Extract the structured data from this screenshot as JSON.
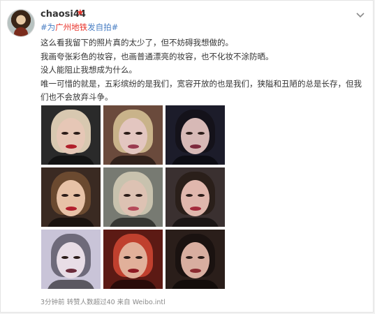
{
  "user": {
    "name": "chaosi44"
  },
  "topic": {
    "prefix": "#为",
    "highlight": "广州地铁",
    "suffix": "发自拍#"
  },
  "post": {
    "lines": [
      "这么看我留下的照片真的太少了，但不妨碍我想做的。",
      "我画夸张彩色的妆容，也画普通漂亮的妆容，也不化妆不涂防晒。",
      "没人能阻止我想成为什么。",
      "唯一可惜的就是，五彩缤纷的是我们，宽容开放的也是我们，狭隘和丑陋的总是长存，但我们也不会放弃斗争。"
    ]
  },
  "photos": [
    {
      "bg": "#2a2a2a",
      "hair": "#d8c8b0",
      "skin": "#e6c7b6",
      "lip": "#b11e2a"
    },
    {
      "bg": "#6a4a3c",
      "hair": "#c9b38a",
      "skin": "#e3c6c0",
      "lip": "#9a3b50"
    },
    {
      "bg": "#1c1c2a",
      "hair": "#14121a",
      "skin": "#d7b9b6",
      "lip": "#7c2a3c"
    },
    {
      "bg": "#3a2a22",
      "hair": "#6b4a30",
      "skin": "#e7c2a7",
      "lip": "#b21f2d"
    },
    {
      "bg": "#777a72",
      "hair": "#c8c2ae",
      "skin": "#ddc2b3",
      "lip": "#b54a5a"
    },
    {
      "bg": "#3a3030",
      "hair": "#2a1f1a",
      "skin": "#e0b7ad",
      "lip": "#a32a3c"
    },
    {
      "bg": "#c9c4d8",
      "hair": "#6e6a7a",
      "skin": "#e8dde6",
      "lip": "#6a2a3a"
    },
    {
      "bg": "#5c1a14",
      "hair": "#c0402e",
      "skin": "#e1b09a",
      "lip": "#8e1a22"
    },
    {
      "bg": "#2a1e1a",
      "hair": "#1a1210",
      "skin": "#d8aea0",
      "lip": "#8a2a30"
    }
  ],
  "footer": {
    "text": "3分钟前 转赞人数超过40 来自 Weibo.intl"
  },
  "colors": {
    "link": "#4a7fc4",
    "accent": "#e8332b",
    "text": "#333333",
    "muted": "#8a8a8a"
  },
  "icons": {
    "badge": "red-star-badge-icon",
    "menu": "chevron-down-icon"
  }
}
